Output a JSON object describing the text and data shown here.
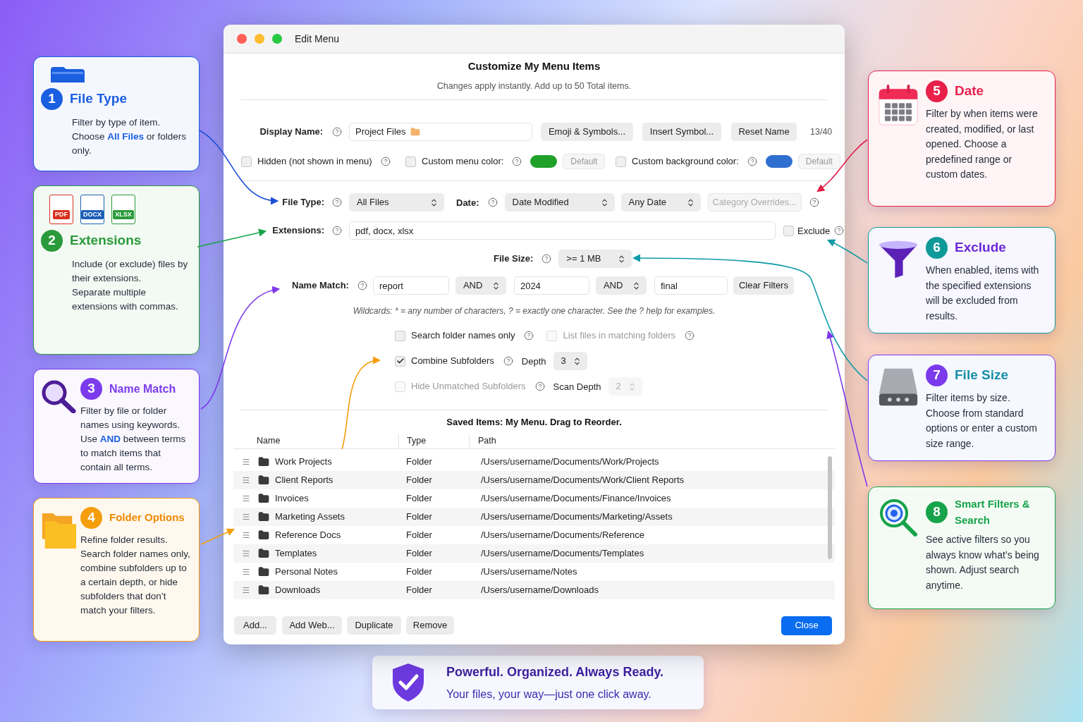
{
  "window": {
    "title": "Edit Menu"
  },
  "header": {
    "title": "Customize My Menu Items",
    "subtitle": "Changes apply instantly. Add up to 50 Total items."
  },
  "display_name": {
    "label": "Display Name:",
    "value": "Project Files",
    "buttons": [
      "Emoji & Symbols...",
      "Insert Symbol...",
      "Reset Name"
    ],
    "counter": "13/40"
  },
  "options": [
    {
      "kind": "checkbox",
      "label": "Hidden (not shown in menu)",
      "checked": false
    },
    {
      "kind": "color",
      "label": "Custom menu color:",
      "checked": false,
      "color": "#1fa12a",
      "button": "Default"
    },
    {
      "kind": "color",
      "label": "Custom background color:",
      "checked": false,
      "color": "#2f6fd0",
      "button": "Default"
    }
  ],
  "file_type": {
    "label": "File Type:",
    "value": "All Files"
  },
  "date": {
    "label": "Date:",
    "field": "Date Modified",
    "range": "Any Date",
    "overrides": "Category Overrides..."
  },
  "extensions": {
    "label": "Extensions:",
    "value": "pdf, docx, xlsx",
    "exclude": {
      "label": "Exclude",
      "checked": false
    }
  },
  "file_size": {
    "label": "File Size:",
    "value": ">= 1 MB"
  },
  "name_match": {
    "label": "Name Match:",
    "terms": [
      "report",
      "2024",
      "final"
    ],
    "operators": [
      "AND",
      "AND"
    ],
    "clear": "Clear Filters"
  },
  "wildcards_note": "Wildcards: * = any number of characters, ? = exactly one character. See the ? help for examples.",
  "folder_rows": [
    {
      "checks": [
        {
          "label": "Search folder names only",
          "checked": false,
          "disabled": false
        },
        {
          "label": "List files in matching folders",
          "checked": false,
          "disabled": true
        }
      ]
    },
    {
      "checks": [
        {
          "label": "Combine Subfolders",
          "checked": true,
          "disabled": false
        }
      ],
      "stepper": {
        "label": "Depth",
        "value": "3",
        "disabled": false
      }
    },
    {
      "checks": [
        {
          "label": "Hide Unmatched Subfolders",
          "checked": false,
          "disabled": true
        }
      ],
      "stepper": {
        "label": "Scan Depth",
        "value": "2",
        "disabled": true
      }
    }
  ],
  "saved_items": {
    "title": "Saved Items: My Menu. Drag to Reorder.",
    "columns": [
      "Name",
      "Type",
      "Path"
    ],
    "rows": [
      {
        "name": "Work Projects",
        "type": "Folder",
        "path": "/Users/username/Documents/Work/Projects"
      },
      {
        "name": "Client Reports",
        "type": "Folder",
        "path": "/Users/username/Documents/Work/Client Reports"
      },
      {
        "name": "Invoices",
        "type": "Folder",
        "path": "/Users/username/Documents/Finance/Invoices"
      },
      {
        "name": "Marketing Assets",
        "type": "Folder",
        "path": "/Users/username/Documents/Marketing/Assets"
      },
      {
        "name": "Reference Docs",
        "type": "Folder",
        "path": "/Users/username/Documents/Reference"
      },
      {
        "name": "Templates",
        "type": "Folder",
        "path": "/Users/username/Documents/Templates"
      },
      {
        "name": "Personal Notes",
        "type": "Folder",
        "path": "/Users/username/Notes"
      },
      {
        "name": "Downloads",
        "type": "Folder",
        "path": "/Users/username/Downloads"
      }
    ]
  },
  "footer_buttons": [
    "Add...",
    "Add Web...",
    "Duplicate",
    "Remove"
  ],
  "close_button": "Close",
  "callouts": [
    {
      "number": "1",
      "title": "File Type",
      "color": "#1a5fe0",
      "text": [
        "Filter by type of item. Choose **All Files** or folders only."
      ]
    },
    {
      "number": "2",
      "title": "Extensions",
      "color": "#2a9a3a",
      "file_badges": [
        "PDF",
        "DOCX",
        "XLSX"
      ],
      "text": [
        "Include (or exclude) files by their extensions.",
        "Separate multiple extensions with commas."
      ]
    },
    {
      "number": "3",
      "title": "Name Match",
      "color": "#7c3aed",
      "text": [
        "Filter by file or folder names using keywords. Use **AND** between terms to match items that contain all terms."
      ]
    },
    {
      "number": "4",
      "title": "Folder Options",
      "color": "#f59e0b",
      "text": [
        "Refine folder results. Search folder names only, combine subfolders up to a certain depth, or hide subfolders that don’t match your filters."
      ]
    },
    {
      "number": "5",
      "title": "Date",
      "color": "#e8204a",
      "text": [
        "Filter by when items were created, modified, or last opened. Choose a predefined range or custom dates."
      ]
    },
    {
      "number": "6",
      "title": "Exclude",
      "color": "#0f9a9a",
      "text": [
        "When enabled, items with the specified extensions will be excluded from results."
      ]
    },
    {
      "number": "7",
      "title": "File Size",
      "color": "#7c3aed",
      "text": [
        "Filter items by size. Choose from standard options or enter a custom size range."
      ]
    },
    {
      "number": "8",
      "title": "Smart Filters & Search",
      "color": "#16a34a",
      "text": [
        "See active filters so you always know what’s being shown. Adjust search anytime."
      ]
    }
  ],
  "banner": {
    "title": "Powerful. Organized. Always Ready.",
    "subtitle": "Your files, your way—just one click away."
  }
}
